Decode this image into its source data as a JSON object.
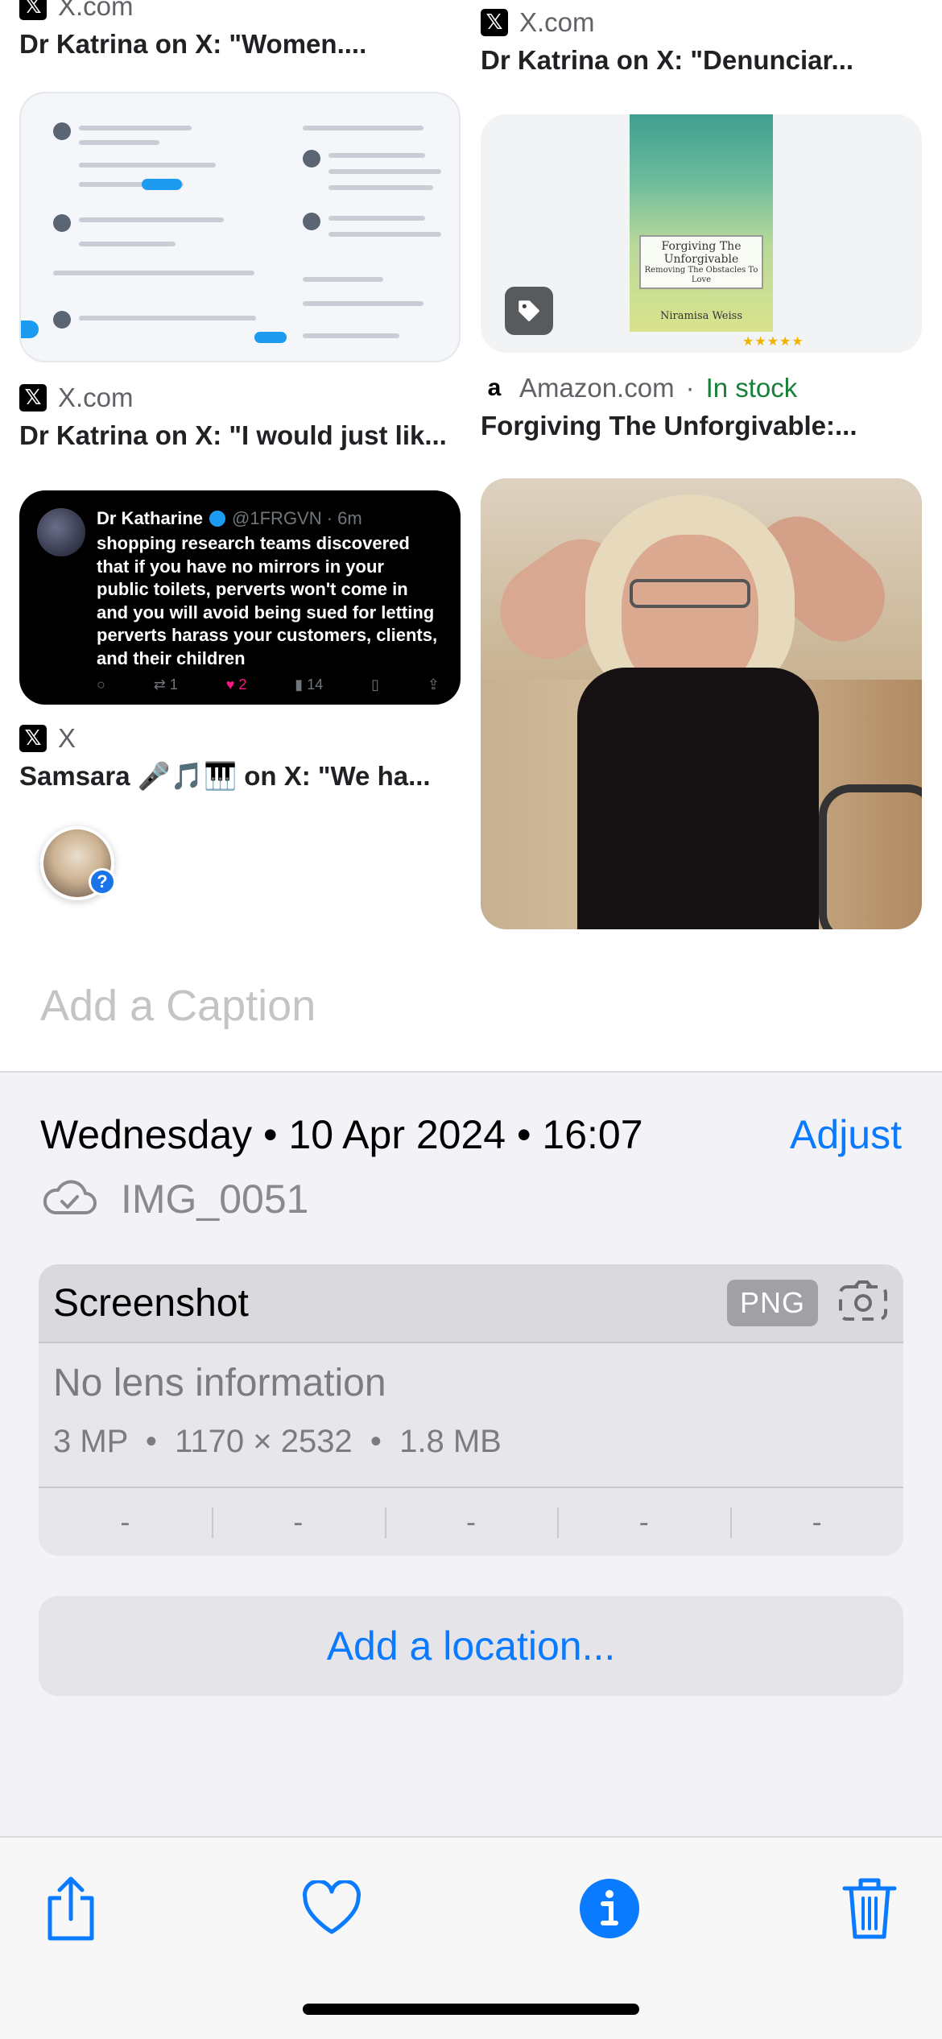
{
  "results": {
    "left": [
      {
        "source": "X.com",
        "title": "Dr Katrina on X: \"Women...."
      },
      {
        "source": "X.com",
        "title": "Dr Katrina on X: \"I would just lik..."
      },
      {
        "source": "X",
        "title": "Samsara 🎤🎵🎹 on X: \"We ha...",
        "tweet": {
          "name": "Dr Katharine",
          "handle": "@1FRGVN · 6m",
          "text": "shopping research teams discovered that if you have no mirrors in your public toilets, perverts won't come in and you will avoid being sued for letting perverts harass your customers, clients, and their children",
          "retweets": "1",
          "likes": "2",
          "views": "14"
        }
      }
    ],
    "right": [
      {
        "source": "X.com",
        "title": "Dr Katrina on X: \"Denunciar..."
      },
      {
        "source": "Amazon.com",
        "stock": "In stock",
        "title": "Forgiving The Unforgivable:...",
        "book_title": "Forgiving The Unforgivable",
        "book_subtitle": "Removing The Obstacles To Love",
        "book_author": "Niramisa Weiss"
      }
    ]
  },
  "caption_placeholder": "Add a Caption",
  "info": {
    "date": "Wednesday • 10 Apr 2024 • 16:07",
    "adjust_label": "Adjust",
    "filename": "IMG_0051",
    "type": "Screenshot",
    "format": "PNG",
    "lens": "No lens information",
    "specs": "3 MP  •  1170 × 2532  •  1.8 MB",
    "exif": [
      "-",
      "-",
      "-",
      "-",
      "-"
    ],
    "location_label": "Add a location..."
  },
  "colors": {
    "accent": "#0a7aff",
    "stock_green": "#188038",
    "panel_bg": "#f2f2f7"
  },
  "icons": [
    "share-icon",
    "heart-icon",
    "info-icon",
    "trash-icon",
    "cloud-check-icon",
    "camera-icon",
    "tag-icon",
    "x-logo-icon",
    "amazon-logo-icon"
  ]
}
